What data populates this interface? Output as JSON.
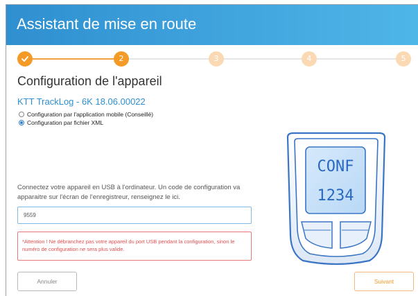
{
  "header": {
    "title": "Assistant de mise en route"
  },
  "stepper": {
    "steps": [
      {
        "label": "",
        "state": "done"
      },
      {
        "label": "2",
        "state": "active"
      },
      {
        "label": "3",
        "state": "todo"
      },
      {
        "label": "4",
        "state": "todo"
      },
      {
        "label": "5",
        "state": "todo"
      }
    ]
  },
  "main": {
    "section_title": "Configuration de l'appareil",
    "device_name": "KTT TrackLog - 6K 18.06.00022",
    "options": [
      {
        "label": "Configuration par l'application mobile (Conseillé)",
        "selected": false
      },
      {
        "label": "Configuration par fichier XML",
        "selected": true
      }
    ],
    "instructions": "Connectez votre appareil en USB à l'ordinateur. Un code de configuration va apparaitre sur l'écran de l'enregistreur, renseignez le ici.",
    "code_input": {
      "value": "9559"
    },
    "warning": "*Attention ! Ne débranchez pas votre appareil du port USB pendant la configuration, sinon le numéro de configuration ne sera plus valide.",
    "device_display": {
      "line1": "CONF",
      "line2": "1234"
    }
  },
  "buttons": {
    "cancel": "Annuler",
    "next": "Suivant"
  },
  "colors": {
    "accent": "#f39a27",
    "header_start": "#2f8fd0",
    "header_end": "#4fb6e8",
    "link": "#2f8fd0",
    "error": "#e14f4f"
  }
}
